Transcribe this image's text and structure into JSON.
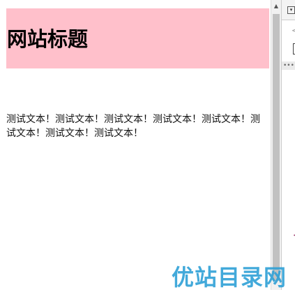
{
  "page": {
    "title": "网站标题",
    "paragraph": "测试文本！测试文本！测试文本！测试文本！测试文本！测试文本！测试文本！测试文本！"
  },
  "header": {
    "background_color": "#ffc0cb"
  },
  "devtools": {
    "dropdown_icon": "▾",
    "ellipsis": "•••"
  },
  "scrollbar": {
    "up_arrow": "▲"
  },
  "watermark": {
    "text": "优站目录网"
  }
}
